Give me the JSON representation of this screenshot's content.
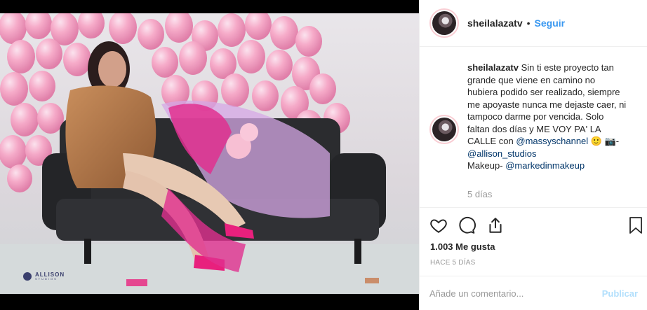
{
  "post": {
    "username": "sheilalazatv",
    "separator": "•",
    "follow_label": "Seguir",
    "caption": {
      "username": "sheilalazatv",
      "line1": "Sin ti este proyecto tan",
      "line2": "grande que viene en camino no",
      "line3": "hubiera podido ser realizado, siempre",
      "line4": "me apoyaste nunca me dejaste caer, ni",
      "line5": "tampoco darme por vencida. Solo",
      "line6_prefix": "faltan dos días y ME VOY PA' LA",
      "line7_prefix": "CALLE con ",
      "mention1": "@massyschannel",
      "emoji": "🙂 📷-",
      "mention2": "@allison_studios",
      "makeup_prefix": "Makeup- ",
      "mention3": "@markedinmakeup"
    },
    "time_ago": "5 días",
    "likes": "1.003 Me gusta",
    "date": "HACE 5 DÍAS",
    "comment_placeholder": "Añade un comentario...",
    "publish_label": "Publicar"
  },
  "photo": {
    "watermark_brand": "ALLISON",
    "watermark_sub": "STUDIOS"
  },
  "colors": {
    "link": "#3897f0",
    "mention": "#003569",
    "muted": "#999999",
    "balloon": "#f4a6c6"
  },
  "icons": [
    "heart-icon",
    "comment-icon",
    "share-icon",
    "bookmark-icon"
  ]
}
